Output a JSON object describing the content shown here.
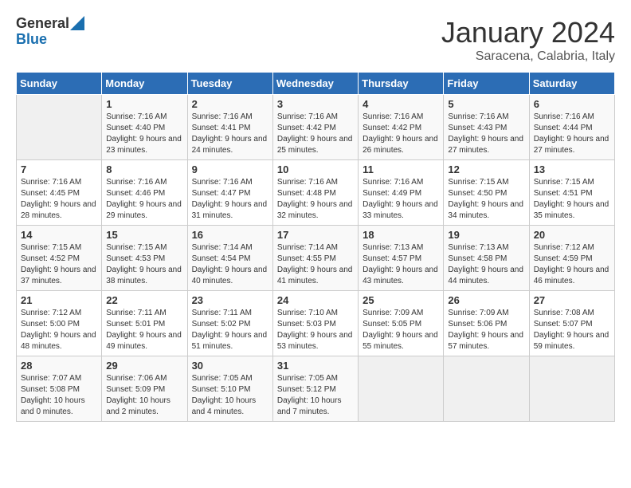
{
  "header": {
    "logo_general": "General",
    "logo_blue": "Blue",
    "month_title": "January 2024",
    "location": "Saracena, Calabria, Italy"
  },
  "days_of_week": [
    "Sunday",
    "Monday",
    "Tuesday",
    "Wednesday",
    "Thursday",
    "Friday",
    "Saturday"
  ],
  "weeks": [
    [
      {
        "day": "",
        "sunrise": "",
        "sunset": "",
        "daylight": ""
      },
      {
        "day": "1",
        "sunrise": "Sunrise: 7:16 AM",
        "sunset": "Sunset: 4:40 PM",
        "daylight": "Daylight: 9 hours and 23 minutes."
      },
      {
        "day": "2",
        "sunrise": "Sunrise: 7:16 AM",
        "sunset": "Sunset: 4:41 PM",
        "daylight": "Daylight: 9 hours and 24 minutes."
      },
      {
        "day": "3",
        "sunrise": "Sunrise: 7:16 AM",
        "sunset": "Sunset: 4:42 PM",
        "daylight": "Daylight: 9 hours and 25 minutes."
      },
      {
        "day": "4",
        "sunrise": "Sunrise: 7:16 AM",
        "sunset": "Sunset: 4:42 PM",
        "daylight": "Daylight: 9 hours and 26 minutes."
      },
      {
        "day": "5",
        "sunrise": "Sunrise: 7:16 AM",
        "sunset": "Sunset: 4:43 PM",
        "daylight": "Daylight: 9 hours and 27 minutes."
      },
      {
        "day": "6",
        "sunrise": "Sunrise: 7:16 AM",
        "sunset": "Sunset: 4:44 PM",
        "daylight": "Daylight: 9 hours and 27 minutes."
      }
    ],
    [
      {
        "day": "7",
        "sunrise": "Sunrise: 7:16 AM",
        "sunset": "Sunset: 4:45 PM",
        "daylight": "Daylight: 9 hours and 28 minutes."
      },
      {
        "day": "8",
        "sunrise": "Sunrise: 7:16 AM",
        "sunset": "Sunset: 4:46 PM",
        "daylight": "Daylight: 9 hours and 29 minutes."
      },
      {
        "day": "9",
        "sunrise": "Sunrise: 7:16 AM",
        "sunset": "Sunset: 4:47 PM",
        "daylight": "Daylight: 9 hours and 31 minutes."
      },
      {
        "day": "10",
        "sunrise": "Sunrise: 7:16 AM",
        "sunset": "Sunset: 4:48 PM",
        "daylight": "Daylight: 9 hours and 32 minutes."
      },
      {
        "day": "11",
        "sunrise": "Sunrise: 7:16 AM",
        "sunset": "Sunset: 4:49 PM",
        "daylight": "Daylight: 9 hours and 33 minutes."
      },
      {
        "day": "12",
        "sunrise": "Sunrise: 7:15 AM",
        "sunset": "Sunset: 4:50 PM",
        "daylight": "Daylight: 9 hours and 34 minutes."
      },
      {
        "day": "13",
        "sunrise": "Sunrise: 7:15 AM",
        "sunset": "Sunset: 4:51 PM",
        "daylight": "Daylight: 9 hours and 35 minutes."
      }
    ],
    [
      {
        "day": "14",
        "sunrise": "Sunrise: 7:15 AM",
        "sunset": "Sunset: 4:52 PM",
        "daylight": "Daylight: 9 hours and 37 minutes."
      },
      {
        "day": "15",
        "sunrise": "Sunrise: 7:15 AM",
        "sunset": "Sunset: 4:53 PM",
        "daylight": "Daylight: 9 hours and 38 minutes."
      },
      {
        "day": "16",
        "sunrise": "Sunrise: 7:14 AM",
        "sunset": "Sunset: 4:54 PM",
        "daylight": "Daylight: 9 hours and 40 minutes."
      },
      {
        "day": "17",
        "sunrise": "Sunrise: 7:14 AM",
        "sunset": "Sunset: 4:55 PM",
        "daylight": "Daylight: 9 hours and 41 minutes."
      },
      {
        "day": "18",
        "sunrise": "Sunrise: 7:13 AM",
        "sunset": "Sunset: 4:57 PM",
        "daylight": "Daylight: 9 hours and 43 minutes."
      },
      {
        "day": "19",
        "sunrise": "Sunrise: 7:13 AM",
        "sunset": "Sunset: 4:58 PM",
        "daylight": "Daylight: 9 hours and 44 minutes."
      },
      {
        "day": "20",
        "sunrise": "Sunrise: 7:12 AM",
        "sunset": "Sunset: 4:59 PM",
        "daylight": "Daylight: 9 hours and 46 minutes."
      }
    ],
    [
      {
        "day": "21",
        "sunrise": "Sunrise: 7:12 AM",
        "sunset": "Sunset: 5:00 PM",
        "daylight": "Daylight: 9 hours and 48 minutes."
      },
      {
        "day": "22",
        "sunrise": "Sunrise: 7:11 AM",
        "sunset": "Sunset: 5:01 PM",
        "daylight": "Daylight: 9 hours and 49 minutes."
      },
      {
        "day": "23",
        "sunrise": "Sunrise: 7:11 AM",
        "sunset": "Sunset: 5:02 PM",
        "daylight": "Daylight: 9 hours and 51 minutes."
      },
      {
        "day": "24",
        "sunrise": "Sunrise: 7:10 AM",
        "sunset": "Sunset: 5:03 PM",
        "daylight": "Daylight: 9 hours and 53 minutes."
      },
      {
        "day": "25",
        "sunrise": "Sunrise: 7:09 AM",
        "sunset": "Sunset: 5:05 PM",
        "daylight": "Daylight: 9 hours and 55 minutes."
      },
      {
        "day": "26",
        "sunrise": "Sunrise: 7:09 AM",
        "sunset": "Sunset: 5:06 PM",
        "daylight": "Daylight: 9 hours and 57 minutes."
      },
      {
        "day": "27",
        "sunrise": "Sunrise: 7:08 AM",
        "sunset": "Sunset: 5:07 PM",
        "daylight": "Daylight: 9 hours and 59 minutes."
      }
    ],
    [
      {
        "day": "28",
        "sunrise": "Sunrise: 7:07 AM",
        "sunset": "Sunset: 5:08 PM",
        "daylight": "Daylight: 10 hours and 0 minutes."
      },
      {
        "day": "29",
        "sunrise": "Sunrise: 7:06 AM",
        "sunset": "Sunset: 5:09 PM",
        "daylight": "Daylight: 10 hours and 2 minutes."
      },
      {
        "day": "30",
        "sunrise": "Sunrise: 7:05 AM",
        "sunset": "Sunset: 5:10 PM",
        "daylight": "Daylight: 10 hours and 4 minutes."
      },
      {
        "day": "31",
        "sunrise": "Sunrise: 7:05 AM",
        "sunset": "Sunset: 5:12 PM",
        "daylight": "Daylight: 10 hours and 7 minutes."
      },
      {
        "day": "",
        "sunrise": "",
        "sunset": "",
        "daylight": ""
      },
      {
        "day": "",
        "sunrise": "",
        "sunset": "",
        "daylight": ""
      },
      {
        "day": "",
        "sunrise": "",
        "sunset": "",
        "daylight": ""
      }
    ]
  ]
}
